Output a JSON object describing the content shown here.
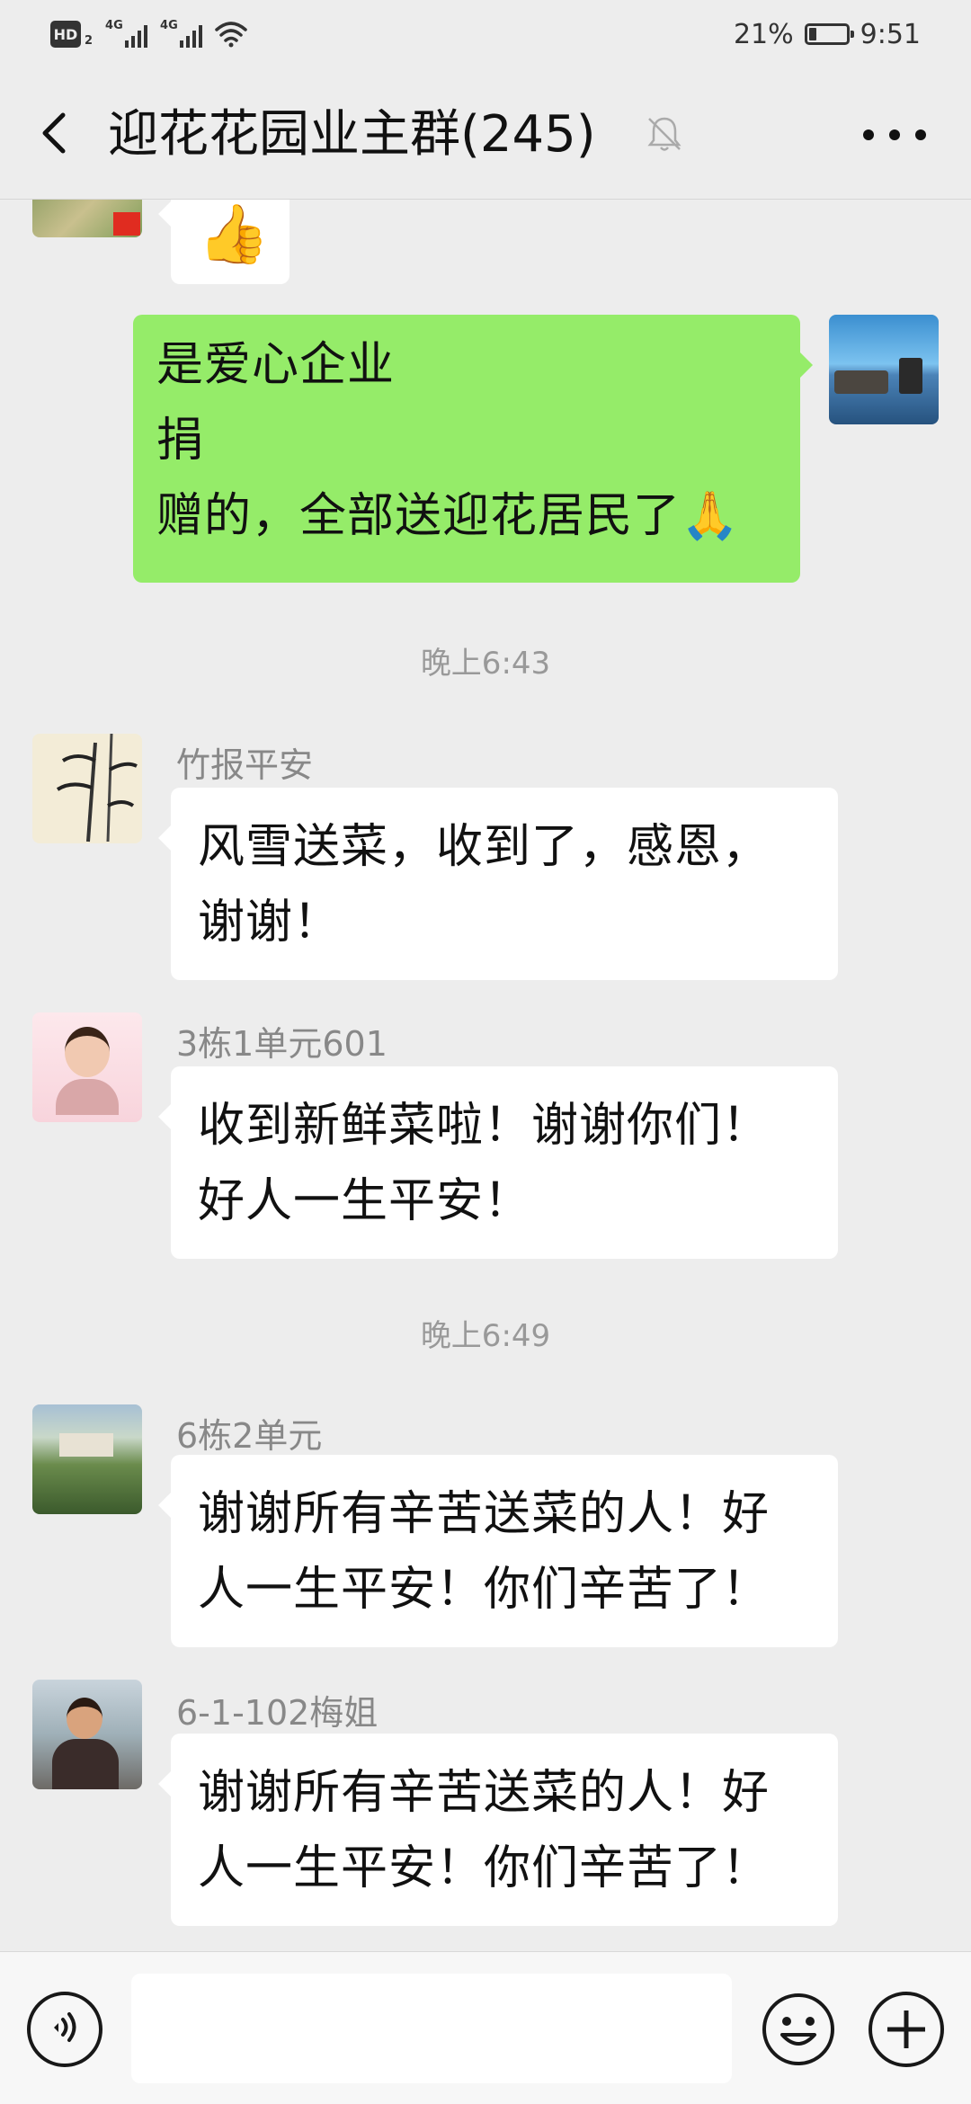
{
  "status_bar": {
    "hd_label": "HD",
    "sim_index": "2",
    "network_1": "4G",
    "network_2": "4G",
    "battery_percent": "21%",
    "battery_level": 0.21,
    "time": "9:51"
  },
  "header": {
    "title": "迎花花园业主群(245)",
    "icons": [
      "back-arrow-icon",
      "muted-bell-icon",
      "more-icon"
    ]
  },
  "messages": [
    {
      "type": "sticker",
      "icon": "thumbs-up-emoji",
      "glyph": "👍"
    },
    {
      "type": "self",
      "text": "是爱心企业\n捐\n赠的，全部送迎花居民了🙏"
    },
    {
      "type": "time",
      "text": "晚上6:43"
    },
    {
      "type": "incoming",
      "sender": "竹报平安",
      "text": "风雪送菜，收到了，感恩，\n谢谢！"
    },
    {
      "type": "incoming",
      "sender": "3栋1单元601",
      "text": "收到新鲜菜啦！谢谢你们！\n好人一生平安！"
    },
    {
      "type": "time",
      "text": "晚上6:49"
    },
    {
      "type": "incoming",
      "sender": "6栋2单元",
      "text": "谢谢所有辛苦送菜的人！好\n人一生平安！你们辛苦了！"
    },
    {
      "type": "incoming",
      "sender": "6-1-102梅姐",
      "text": "谢谢所有辛苦送菜的人！好\n人一生平安！你们辛苦了！"
    }
  ],
  "input_bar": {
    "placeholder": "",
    "icons": [
      "voice-icon",
      "emoji-icon",
      "plus-icon"
    ]
  },
  "colors": {
    "background": "#ededed",
    "self_bubble": "#95ec69",
    "other_bubble": "#ffffff",
    "muted_text": "#888888"
  }
}
